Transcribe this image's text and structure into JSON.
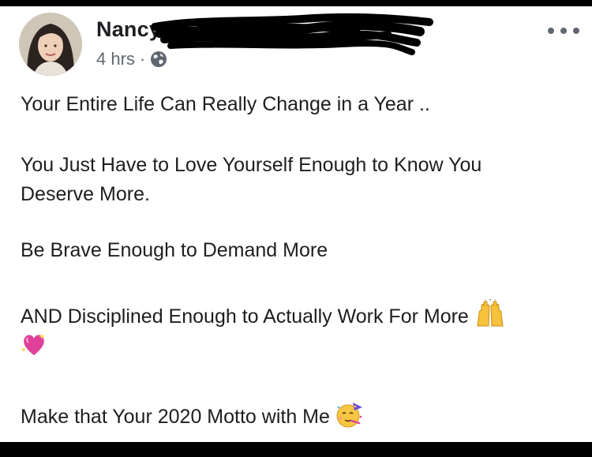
{
  "post": {
    "author_name": "Nancy",
    "time_ago": "4 hrs",
    "separator": "·",
    "privacy_icon": "globe-icon",
    "more_icon": "more-options-icon",
    "lines": {
      "line1": "Your Entire Life Can Really Change in a Year ..",
      "line2a": "You Just Have to Love Yourself Enough to Know You",
      "line2b": "Deserve More.",
      "line3": "Be Brave Enough to Demand More",
      "line4": "AND Disciplined Enough to Actually Work For More",
      "line5": "Make that Your 2020 Motto with Me"
    },
    "emojis": {
      "raised_hands": "raised-hands-emoji",
      "sparkling_heart": "sparkling-heart-emoji",
      "partying_face": "partying-face-emoji"
    }
  },
  "colors": {
    "text": "#1c1e21",
    "meta": "#616770",
    "redaction": "#000000",
    "background": "#ffffff"
  }
}
